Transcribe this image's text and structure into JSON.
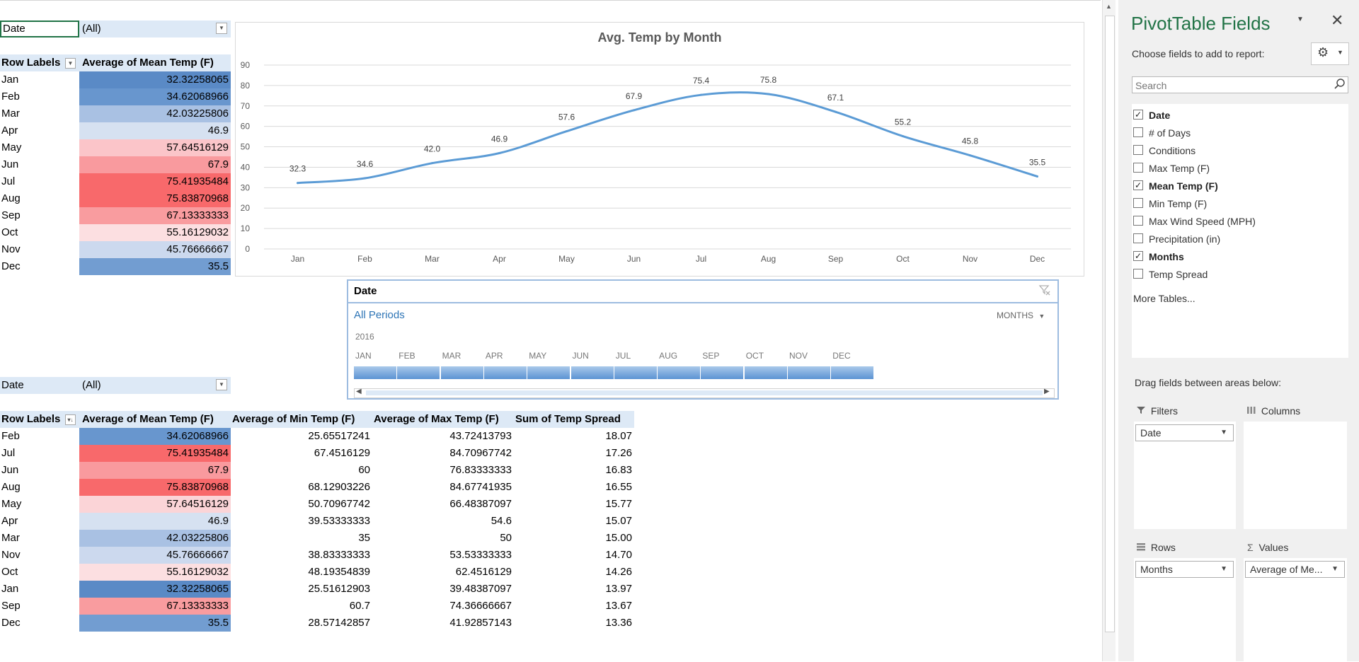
{
  "pivot1": {
    "filter_label": "Date",
    "filter_value": "(All)",
    "headers": [
      "Row Labels",
      "Average of Mean Temp (F)"
    ],
    "rows": [
      {
        "label": "Jan",
        "value": "32.32258065",
        "color": "#5a8ac6"
      },
      {
        "label": "Feb",
        "value": "34.62068966",
        "color": "#6896ce"
      },
      {
        "label": "Mar",
        "value": "42.03225806",
        "color": "#a9c1e3"
      },
      {
        "label": "Apr",
        "value": "46.9",
        "color": "#d6e1f1"
      },
      {
        "label": "May",
        "value": "57.64516129",
        "color": "#fbc5c9"
      },
      {
        "label": "Jun",
        "value": "67.9",
        "color": "#f99a9e"
      },
      {
        "label": "Jul",
        "value": "75.41935484",
        "color": "#f8696b"
      },
      {
        "label": "Aug",
        "value": "75.83870968",
        "color": "#f8696b"
      },
      {
        "label": "Sep",
        "value": "67.13333333",
        "color": "#f99c9f"
      },
      {
        "label": "Oct",
        "value": "55.16129032",
        "color": "#fcdfe1"
      },
      {
        "label": "Nov",
        "value": "45.76666667",
        "color": "#ccd9ee"
      },
      {
        "label": "Dec",
        "value": "35.5",
        "color": "#729dd1"
      }
    ]
  },
  "pivot2": {
    "filter_label": "Date",
    "filter_value": "(All)",
    "headers": [
      "Row Labels",
      "Average of Mean Temp (F)",
      "Average of Min Temp (F)",
      "Average of Max Temp (F)",
      "Sum of Temp Spread"
    ],
    "rows": [
      {
        "label": "Feb",
        "mean": "34.62068966",
        "min": "25.65517241",
        "max": "43.72413793",
        "spread": "18.07",
        "color": "#6896ce"
      },
      {
        "label": "Jul",
        "mean": "75.41935484",
        "min": "67.4516129",
        "max": "84.70967742",
        "spread": "17.26",
        "color": "#f8696b"
      },
      {
        "label": "Jun",
        "mean": "67.9",
        "min": "60",
        "max": "76.83333333",
        "spread": "16.83",
        "color": "#f99a9e"
      },
      {
        "label": "Aug",
        "mean": "75.83870968",
        "min": "68.12903226",
        "max": "84.67741935",
        "spread": "16.55",
        "color": "#f8696b"
      },
      {
        "label": "May",
        "mean": "57.64516129",
        "min": "50.70967742",
        "max": "66.48387097",
        "spread": "15.77",
        "color": "#fbd4d7"
      },
      {
        "label": "Apr",
        "mean": "46.9",
        "min": "39.53333333",
        "max": "54.6",
        "spread": "15.07",
        "color": "#d6e1f1"
      },
      {
        "label": "Mar",
        "mean": "42.03225806",
        "min": "35",
        "max": "50",
        "spread": "15.00",
        "color": "#a9c1e3"
      },
      {
        "label": "Nov",
        "mean": "45.76666667",
        "min": "38.83333333",
        "max": "53.53333333",
        "spread": "14.70",
        "color": "#ccd9ee"
      },
      {
        "label": "Oct",
        "mean": "55.16129032",
        "min": "48.19354839",
        "max": "62.4516129",
        "spread": "14.26",
        "color": "#fcdfe1"
      },
      {
        "label": "Jan",
        "mean": "32.32258065",
        "min": "25.51612903",
        "max": "39.48387097",
        "spread": "13.97",
        "color": "#5a8ac6"
      },
      {
        "label": "Sep",
        "mean": "67.13333333",
        "min": "60.7",
        "max": "74.36666667",
        "spread": "13.67",
        "color": "#f99c9f"
      },
      {
        "label": "Dec",
        "mean": "35.5",
        "min": "28.57142857",
        "max": "41.92857143",
        "spread": "13.36",
        "color": "#729dd1"
      }
    ]
  },
  "chart_data": {
    "type": "line",
    "title": "Avg. Temp by Month",
    "categories": [
      "Jan",
      "Feb",
      "Mar",
      "Apr",
      "May",
      "Jun",
      "Jul",
      "Aug",
      "Sep",
      "Oct",
      "Nov",
      "Dec"
    ],
    "values": [
      32.3,
      34.6,
      42.0,
      46.9,
      57.6,
      67.9,
      75.4,
      75.8,
      67.1,
      55.2,
      45.8,
      35.5
    ],
    "data_labels": [
      "32.3",
      "34.6",
      "42.0",
      "46.9",
      "57.6",
      "67.9",
      "75.4",
      "75.8",
      "67.1",
      "55.2",
      "45.8",
      "35.5"
    ],
    "ylim": [
      0,
      90
    ],
    "yticks": [
      "0",
      "10",
      "20",
      "30",
      "40",
      "50",
      "60",
      "70",
      "80",
      "90"
    ],
    "grid": true,
    "smooth": true,
    "color": "#5b9bd5"
  },
  "slicer": {
    "title": "Date",
    "all_periods": "All Periods",
    "level": "MONTHS",
    "year": "2016",
    "months": [
      "JAN",
      "FEB",
      "MAR",
      "APR",
      "MAY",
      "JUN",
      "JUL",
      "AUG",
      "SEP",
      "OCT",
      "NOV",
      "DEC"
    ]
  },
  "panel": {
    "title": "PivotTable Fields",
    "subtitle": "Choose fields to add to report:",
    "search_placeholder": "Search",
    "fields": [
      {
        "label": "Date",
        "checked": true
      },
      {
        "label": "# of Days",
        "checked": false
      },
      {
        "label": "Conditions",
        "checked": false
      },
      {
        "label": "Max Temp (F)",
        "checked": false
      },
      {
        "label": "Mean Temp (F)",
        "checked": true
      },
      {
        "label": "Min Temp (F)",
        "checked": false
      },
      {
        "label": "Max Wind Speed (MPH)",
        "checked": false
      },
      {
        "label": "Precipitation (in)",
        "checked": false
      },
      {
        "label": "Months",
        "checked": true
      },
      {
        "label": "Temp Spread",
        "checked": false
      }
    ],
    "more_tables": "More Tables...",
    "drag_hint": "Drag fields between areas below:",
    "areas": {
      "filters": {
        "label": "Filters",
        "item": "Date"
      },
      "columns": {
        "label": "Columns"
      },
      "rows": {
        "label": "Rows",
        "item": "Months"
      },
      "values": {
        "label": "Values",
        "item": "Average of Me..."
      }
    }
  }
}
